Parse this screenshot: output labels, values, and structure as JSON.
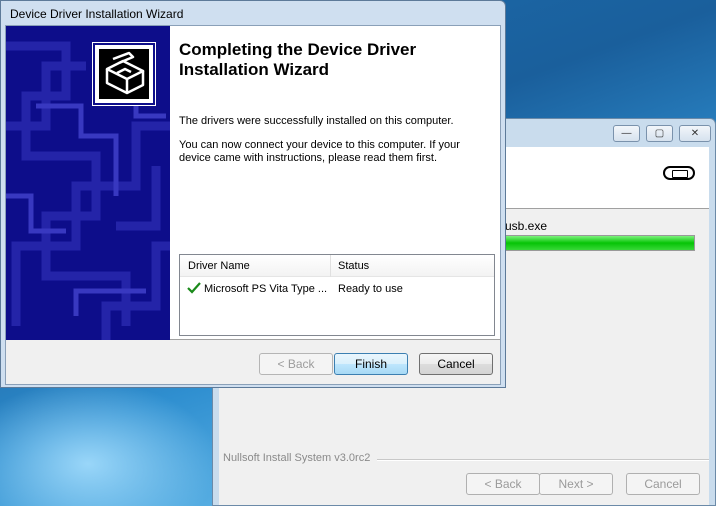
{
  "wizard": {
    "window_title": "Device Driver Installation Wizard",
    "heading": "Completing the Device Driver Installation Wizard",
    "message_success": "The drivers were successfully installed on this computer.",
    "message_connect": "You can now connect your device to this computer. If your device came with instructions, please read them first.",
    "table": {
      "columns": [
        "Driver Name",
        "Status"
      ],
      "rows": [
        {
          "name": "Microsoft PS Vita Type ...",
          "status": "Ready to use",
          "icon": "green-check-icon"
        }
      ]
    },
    "buttons": {
      "back": "< Back",
      "finish": "Finish",
      "cancel": "Cancel"
    }
  },
  "installer": {
    "current_file": "usb.exe",
    "progress": 1.0,
    "branding": "Nullsoft Install System v3.0rc2",
    "window_controls": {
      "minimize": "—",
      "maximize": "▢",
      "close": "✕"
    },
    "buttons": {
      "back": "< Back",
      "next": "Next >",
      "cancel": "Cancel"
    }
  },
  "colors": {
    "banner_blue": "#0d0d8a",
    "progress_green": "#06c406",
    "check_green": "#1a8a1a"
  }
}
